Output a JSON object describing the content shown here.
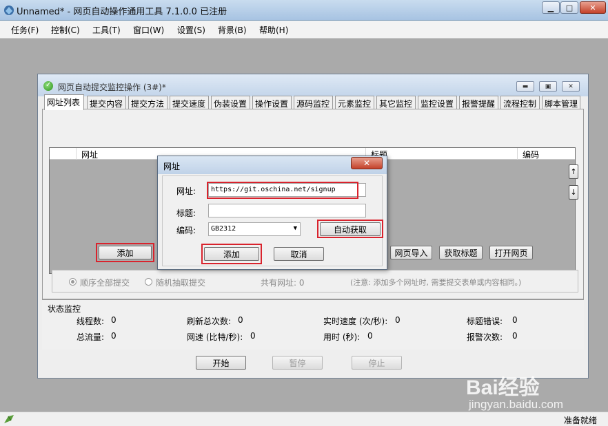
{
  "window": {
    "title": "Unnamed* - 网页自动操作通用工具 7.1.0.0  已注册"
  },
  "menu": [
    "任务(F)",
    "控制(C)",
    "工具(T)",
    "窗口(W)",
    "设置(S)",
    "背景(B)",
    "帮助(H)"
  ],
  "child": {
    "title": "网页自动提交监控操作  (3#)*",
    "tabs": [
      "网址列表",
      "提交内容",
      "提交方法",
      "提交速度",
      "伪装设置",
      "操作设置",
      "源码监控",
      "元素监控",
      "其它监控",
      "监控设置",
      "报警提醒",
      "流程控制",
      "脚本管理"
    ],
    "list_headers": [
      "网址",
      "标题",
      "编码"
    ],
    "side_buttons": [
      "↑",
      "↓"
    ],
    "buttons": {
      "add": "添加",
      "import": "网页导入",
      "get_title": "获取标题",
      "open": "打开网页"
    },
    "radios": {
      "sequential": "顺序全部提交",
      "random": "随机抽取提交"
    },
    "total_urls": "共有网址: 0",
    "note": "(注意: 添加多个网址时, 需要提交表单或内容相同。)"
  },
  "status_monitor": {
    "title": "状态监控",
    "items": [
      {
        "label": "线程数:",
        "value": "0"
      },
      {
        "label": "刷新总次数:",
        "value": "0"
      },
      {
        "label": "实时速度 (次/秒):",
        "value": "0"
      },
      {
        "label": "标题错误:",
        "value": "0"
      },
      {
        "label": "总流量:",
        "value": "0"
      },
      {
        "label": "网速 (比特/秒):",
        "value": "0"
      },
      {
        "label": "用时 (秒):",
        "value": "0"
      },
      {
        "label": "报警次数:",
        "value": "0"
      }
    ],
    "buttons": {
      "start": "开始",
      "pause": "暂停",
      "stop": "停止"
    }
  },
  "dialog": {
    "title": "网址",
    "url_label": "网址:",
    "url_value": "https://git.oschina.net/signup",
    "title_label": "标题:",
    "title_value": "",
    "encoding_label": "编码:",
    "encoding_value": "GB2312",
    "auto_button": "自动获取",
    "add_button": "添加",
    "cancel_button": "取消"
  },
  "statusbar": {
    "text": "准备就绪"
  },
  "watermark": {
    "brand": "Bai经验",
    "url": "jingyan.baidu.com"
  },
  "colors": {
    "highlight": "#d9232d",
    "list_background": "#ababab"
  }
}
